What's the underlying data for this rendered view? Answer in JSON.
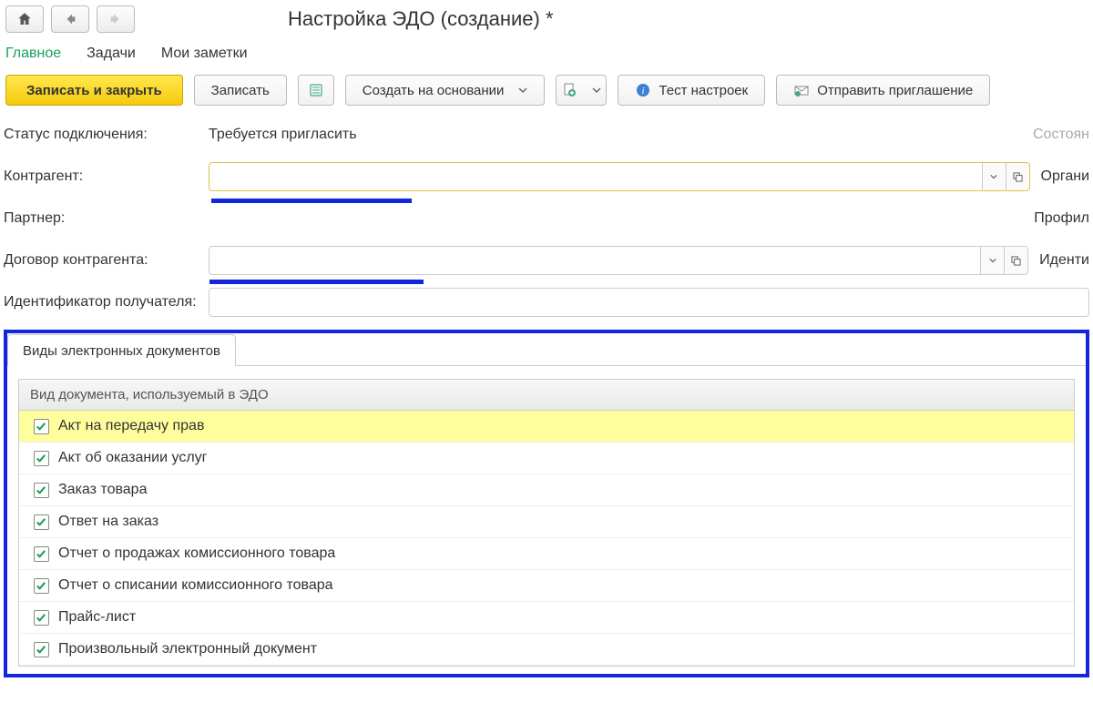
{
  "title": "Настройка ЭДО (создание) *",
  "tabs": {
    "main": "Главное",
    "tasks": "Задачи",
    "notes": "Мои заметки"
  },
  "toolbar": {
    "save_close": "Записать и закрыть",
    "save": "Записать",
    "create_based_on": "Создать на основании",
    "test_settings": "Тест настроек",
    "send_invite": "Отправить приглашение"
  },
  "form": {
    "status_label": "Статус подключения:",
    "status_value": "Требуется пригласить",
    "status_right": "Состоян",
    "counterparty_label": "Контрагент:",
    "counterparty_right": "Органи",
    "partner_label": "Партнер:",
    "partner_right": "Профил",
    "contract_label": "Договор контрагента:",
    "contract_right": "Иденти",
    "recipient_id_label": "Идентификатор получателя:"
  },
  "doc_types": {
    "tab_label": "Виды электронных документов",
    "column_header": "Вид документа, используемый в ЭДО",
    "rows": [
      {
        "label": "Акт на передачу прав",
        "checked": true,
        "selected": true
      },
      {
        "label": "Акт об оказании услуг",
        "checked": true,
        "selected": false
      },
      {
        "label": "Заказ товара",
        "checked": true,
        "selected": false
      },
      {
        "label": "Ответ на заказ",
        "checked": true,
        "selected": false
      },
      {
        "label": "Отчет о продажах комиссионного товара",
        "checked": true,
        "selected": false
      },
      {
        "label": "Отчет о списании комиссионного товара",
        "checked": true,
        "selected": false
      },
      {
        "label": "Прайс-лист",
        "checked": true,
        "selected": false
      },
      {
        "label": "Произвольный электронный документ",
        "checked": true,
        "selected": false
      }
    ]
  }
}
